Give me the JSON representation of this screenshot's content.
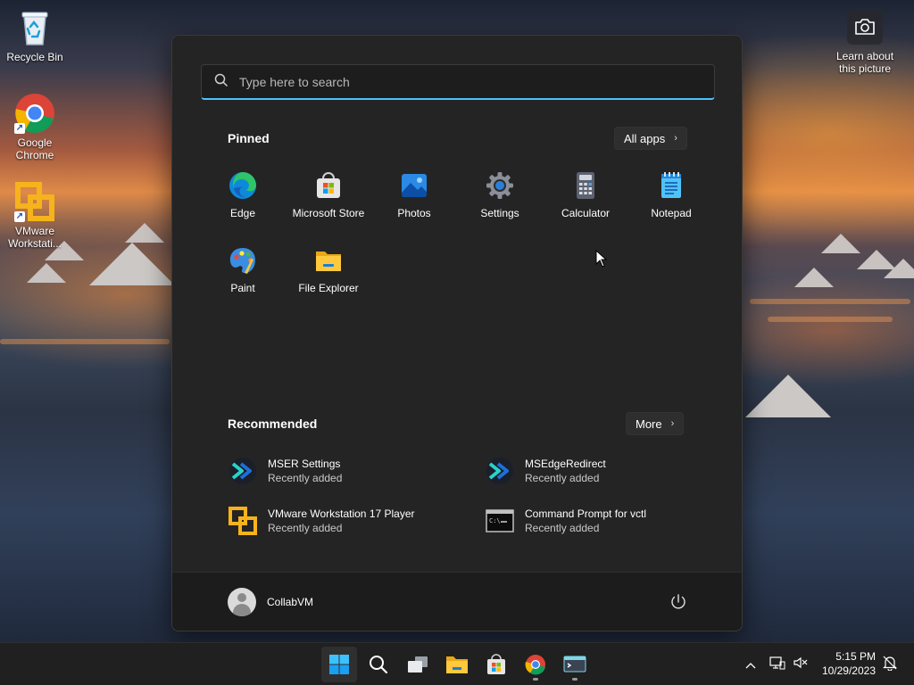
{
  "desktop": {
    "icons": [
      {
        "label": "Recycle Bin"
      },
      {
        "label": "Google Chrome"
      },
      {
        "label": "VMware Workstati..."
      }
    ],
    "spotlight_label": "Learn about this picture"
  },
  "start_menu": {
    "search": {
      "placeholder": "Type here to search"
    },
    "pinned": {
      "title": "Pinned",
      "all_apps_label": "All apps",
      "apps": [
        {
          "label": "Edge",
          "icon": "edge-icon"
        },
        {
          "label": "Microsoft Store",
          "icon": "microsoft-store-icon"
        },
        {
          "label": "Photos",
          "icon": "photos-icon"
        },
        {
          "label": "Settings",
          "icon": "settings-gear-icon"
        },
        {
          "label": "Calculator",
          "icon": "calculator-icon"
        },
        {
          "label": "Notepad",
          "icon": "notepad-icon"
        },
        {
          "label": "Paint",
          "icon": "paint-palette-icon"
        },
        {
          "label": "File Explorer",
          "icon": "folder-icon"
        }
      ]
    },
    "recommended": {
      "title": "Recommended",
      "more_label": "More",
      "items": [
        {
          "name": "MSER Settings",
          "sub": "Recently added",
          "icon": "mser-icon"
        },
        {
          "name": "MSEdgeRedirect",
          "sub": "Recently added",
          "icon": "msedgeredirect-icon"
        },
        {
          "name": "VMware Workstation 17 Player",
          "sub": "Recently added",
          "icon": "vmware-icon"
        },
        {
          "name": "Command Prompt for vctl",
          "sub": "Recently added",
          "icon": "command-prompt-icon"
        }
      ]
    },
    "footer": {
      "user_name": "CollabVM"
    }
  },
  "taskbar": {
    "apps": [
      "start-icon",
      "search-icon",
      "task-view-icon",
      "file-explorer-icon",
      "microsoft-store-icon",
      "chrome-icon",
      "terminal-icon"
    ],
    "clock": {
      "time": "5:15 PM",
      "date": "10/29/2023"
    }
  },
  "colors": {
    "accent": "#4cc2ff",
    "menu_bg": "#242424",
    "taskbar_bg": "#202020"
  }
}
